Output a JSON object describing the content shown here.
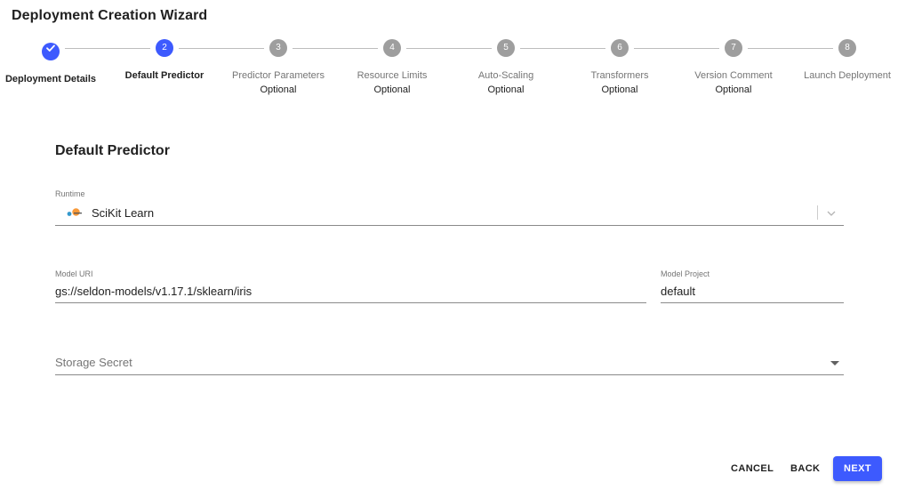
{
  "header": {
    "title": "Deployment Creation Wizard"
  },
  "stepper": {
    "steps": [
      {
        "number": "1",
        "label": "Deployment Details",
        "optional": "",
        "state": "completed",
        "icon": "check-icon"
      },
      {
        "number": "2",
        "label": "Default Predictor",
        "optional": "",
        "state": "active"
      },
      {
        "number": "3",
        "label": "Predictor Parameters",
        "optional": "Optional",
        "state": "pending"
      },
      {
        "number": "4",
        "label": "Resource Limits",
        "optional": "Optional",
        "state": "pending"
      },
      {
        "number": "5",
        "label": "Auto-Scaling",
        "optional": "Optional",
        "state": "pending"
      },
      {
        "number": "6",
        "label": "Transformers",
        "optional": "Optional",
        "state": "pending"
      },
      {
        "number": "7",
        "label": "Version Comment",
        "optional": "Optional",
        "state": "pending"
      },
      {
        "number": "8",
        "label": "Launch Deployment",
        "optional": "",
        "state": "pending"
      }
    ]
  },
  "form": {
    "section_title": "Default Predictor",
    "runtime": {
      "label": "Runtime",
      "value": "SciKit Learn",
      "icon": "scikit-learn-logo-icon"
    },
    "model_uri": {
      "label": "Model URI",
      "value": "gs://seldon-models/v1.17.1/sklearn/iris"
    },
    "model_project": {
      "label": "Model Project",
      "value": "default"
    },
    "storage_secret": {
      "placeholder": "Storage Secret",
      "value": ""
    }
  },
  "actions": {
    "cancel": "CANCEL",
    "back": "BACK",
    "next": "NEXT"
  },
  "colors": {
    "accent": "#3d5afe",
    "pending_step": "#9e9e9e",
    "connector": "#bdbdbd"
  }
}
